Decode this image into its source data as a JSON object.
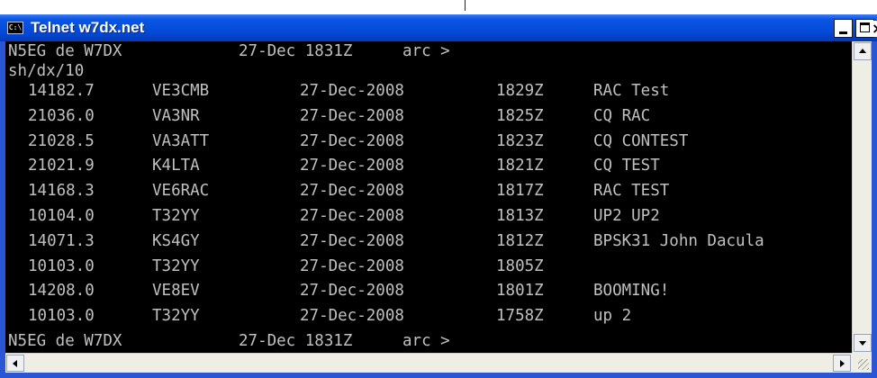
{
  "window": {
    "title": "Telnet w7dx.net",
    "icon": "console-icon"
  },
  "console": {
    "header": "N5EG de W7DX",
    "header_date": "27-Dec 1831Z",
    "header_prompt": "arc >",
    "command": "sh/dx/10",
    "spots": [
      {
        "freq": "14182.7",
        "call": "VE3CMB",
        "date": "27-Dec-2008",
        "time": "1829Z",
        "comment": "RAC Test"
      },
      {
        "freq": "21036.0",
        "call": "VA3NR",
        "date": "27-Dec-2008",
        "time": "1825Z",
        "comment": "CQ RAC"
      },
      {
        "freq": "21028.5",
        "call": "VA3ATT",
        "date": "27-Dec-2008",
        "time": "1823Z",
        "comment": "CQ CONTEST"
      },
      {
        "freq": "21021.9",
        "call": "K4LTA",
        "date": "27-Dec-2008",
        "time": "1821Z",
        "comment": "CQ TEST"
      },
      {
        "freq": "14168.3",
        "call": "VE6RAC",
        "date": "27-Dec-2008",
        "time": "1817Z",
        "comment": "RAC TEST"
      },
      {
        "freq": "10104.0",
        "call": "T32YY",
        "date": "27-Dec-2008",
        "time": "1813Z",
        "comment": "UP2 UP2"
      },
      {
        "freq": "14071.3",
        "call": "KS4GY",
        "date": "27-Dec-2008",
        "time": "1812Z",
        "comment": "BPSK31 John Dacula"
      },
      {
        "freq": "10103.0",
        "call": "T32YY",
        "date": "27-Dec-2008",
        "time": "1805Z",
        "comment": ""
      },
      {
        "freq": "14208.0",
        "call": "VE8EV",
        "date": "27-Dec-2008",
        "time": "1801Z",
        "comment": "BOOMING!"
      },
      {
        "freq": "10103.0",
        "call": "T32YY",
        "date": "27-Dec-2008",
        "time": "1758Z",
        "comment": "up 2"
      }
    ],
    "footer": "N5EG de W7DX",
    "footer_date": "27-Dec 1831Z",
    "footer_prompt": "arc >"
  },
  "colors": {
    "titlebar": "#0548d6",
    "console_bg": "#000000",
    "console_text": "#c0c0c0"
  }
}
